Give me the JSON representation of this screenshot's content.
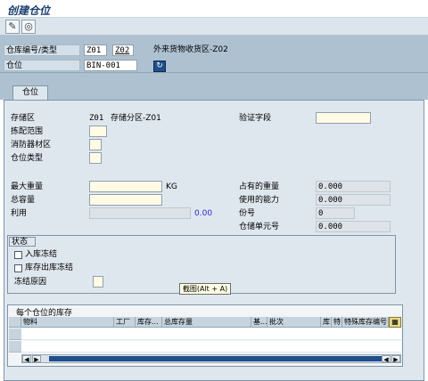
{
  "window": {
    "title": "创建仓位"
  },
  "toolbar": {
    "edit_icon": "pencil-icon",
    "display_icon": "glasses-icon"
  },
  "header": {
    "warehouse_label": "仓库编号/类型",
    "warehouse_no": "Z01",
    "storage_type": "Z02",
    "storage_type_desc": "外来货物收货区-Z02",
    "bin_label": "仓位",
    "bin_value": "BIN-001"
  },
  "tabs": [
    {
      "label": "仓位"
    }
  ],
  "form": {
    "storage_section_label": "存储区",
    "storage_section_value": "Z01",
    "storage_section_desc": "存储分区-Z01",
    "verification_label": "验证字段",
    "picking_area_label": "拣配范围",
    "fire_area_label": "消防器材区",
    "bin_type_label": "仓位类型",
    "max_weight_label": "最大重量",
    "weight_unit": "KG",
    "total_capacity_label": "总容量",
    "utilization_label": "利用",
    "utilization_value": "0.00",
    "occupied_weight_label": "占有的重量",
    "occupied_weight_value": "0.000",
    "used_capacity_label": "使用的能力",
    "used_capacity_value": "0.000",
    "quant_count_label": "份号",
    "quant_count_value": "0",
    "storage_units_label": "仓储单元号",
    "storage_units_value": "0.000"
  },
  "status": {
    "title": "状态",
    "putaway_block_label": "入库冻结",
    "removal_block_label": "库存出库冻结",
    "block_reason_label": "冻结原因"
  },
  "tooltip": {
    "text": "截图(Alt + A)"
  },
  "stock_table": {
    "title": "每个仓位的库存",
    "columns": [
      "物料",
      "工厂",
      "库存...",
      "总库存量",
      "基...",
      "批次",
      "库",
      "特",
      "特殊库存编号"
    ],
    "settings_icon": "table-settings-icon"
  }
}
